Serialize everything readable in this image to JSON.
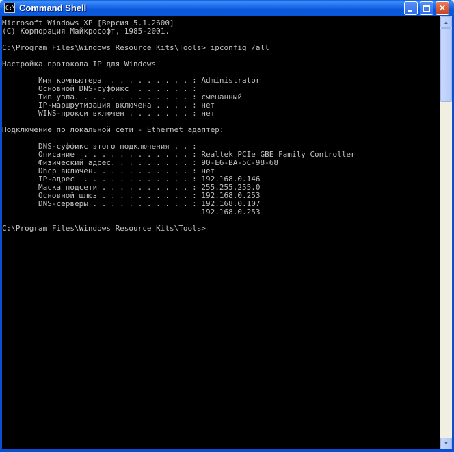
{
  "window": {
    "title": "Command Shell",
    "icon_label": "C:\\",
    "icon": "console-icon",
    "controls": {
      "minimize": "minimize-icon",
      "maximize": "maximize-icon",
      "close": "✕"
    }
  },
  "console": {
    "lines": [
      "Microsoft Windows XP [Версия 5.1.2600]",
      "(С) Корпорация Майкрософт, 1985-2001.",
      "",
      "C:\\Program Files\\Windows Resource Kits\\Tools> ipconfig /all",
      "",
      "Настройка протокола IP для Windows",
      "",
      "        Имя компьютера  . . . . . . . . . : Administrator",
      "        Основной DNS-суффикс  . . . . . . :",
      "        Тип узла. . . . . . . . . . . . . : смешанный",
      "        IP-маршрутизация включена . . . . : нет",
      "        WINS-прокси включен . . . . . . . : нет",
      "",
      "Подключение по локальной сети - Ethernet адаптер:",
      "",
      "        DNS-суффикс этого подключения . . :",
      "        Описание  . . . . . . . . . . . . : Realtek PCIe GBE Family Controller",
      "        Физический адрес. . . . . . . . . : 90-E6-BA-5C-98-68",
      "        Dhcp включен. . . . . . . . . . . : нет",
      "        IP-адрес  . . . . . . . . . . . . : 192.168.0.146",
      "        Маска подсети . . . . . . . . . . : 255.255.255.0",
      "        Основной шлюз . . . . . . . . . . : 192.168.0.253",
      "        DNS-серверы . . . . . . . . . . . : 192.168.0.107",
      "                                            192.168.0.253",
      "",
      "C:\\Program Files\\Windows Resource Kits\\Tools>"
    ]
  },
  "scrollbar": {
    "up": "▲",
    "down": "▼"
  },
  "colors": {
    "console_bg": "#000000",
    "console_fg": "#c0c0c0",
    "titlebar": "#0a56d8"
  }
}
